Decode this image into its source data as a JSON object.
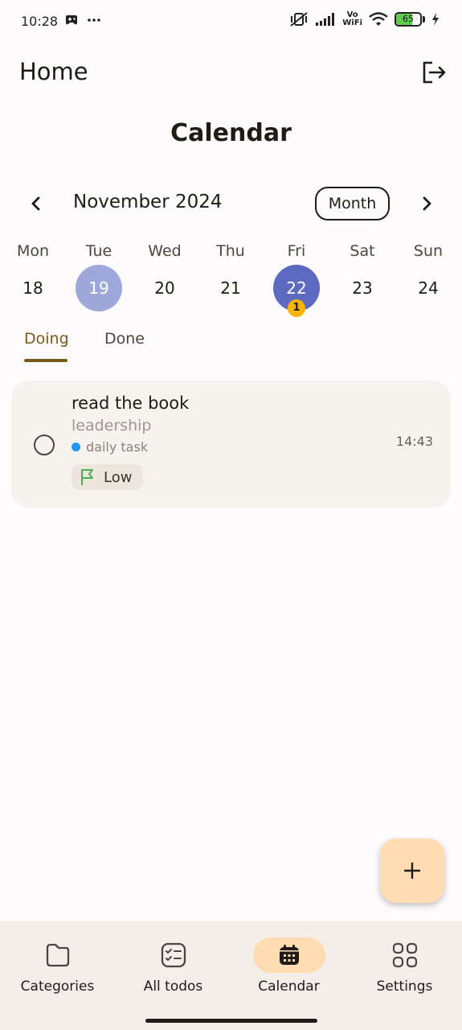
{
  "status_bar": {
    "time": "10:28",
    "battery": "65",
    "vowifi_top": "Vo",
    "vowifi_bottom": "WiFi"
  },
  "app_bar": {
    "title": "Home"
  },
  "page": {
    "heading": "Calendar"
  },
  "calendar": {
    "month_label": "November 2024",
    "format_button": "Month",
    "weekdays": [
      "Mon",
      "Tue",
      "Wed",
      "Thu",
      "Fri",
      "Sat",
      "Sun"
    ],
    "days": [
      "18",
      "19",
      "20",
      "21",
      "22",
      "23",
      "24"
    ],
    "selected_day": "19",
    "today": "22",
    "event_badge_count": "1"
  },
  "tabs": {
    "doing": "Doing",
    "done": "Done"
  },
  "todos": [
    {
      "title": "read the book",
      "description": "leadership",
      "category": "daily task",
      "time": "14:43",
      "priority": "Low",
      "category_color": "#2196f3",
      "priority_color": "#4caf50"
    }
  ],
  "bottom_nav": {
    "items": [
      {
        "label": "Categories",
        "icon": "folder-icon"
      },
      {
        "label": "All todos",
        "icon": "checklist-icon"
      },
      {
        "label": "Calendar",
        "icon": "calendar-icon"
      },
      {
        "label": "Settings",
        "icon": "grid-icon"
      }
    ]
  },
  "colors": {
    "accent": "#7a5a1b",
    "fab": "#ffdcb2",
    "selected_day": "#9fa8da",
    "today": "#5c6bc0",
    "badge": "#f7b500"
  }
}
